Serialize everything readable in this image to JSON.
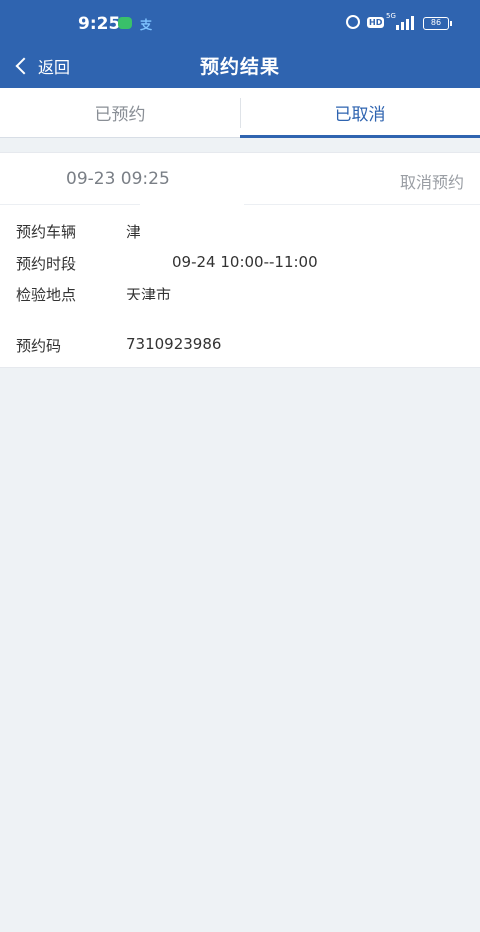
{
  "status_bar": {
    "time": "9:25",
    "alipay_glyph": "支",
    "hd": "HD",
    "network": "5G",
    "battery": "86"
  },
  "nav": {
    "back_label": "返回",
    "title": "预约结果"
  },
  "tabs": [
    {
      "label": "已预约",
      "active": false
    },
    {
      "label": "已取消",
      "active": true
    }
  ],
  "record": {
    "date": "09-23 09:25",
    "cancel_label": "取消预约",
    "fields": {
      "vehicle_label": "预约车辆",
      "vehicle_value": "津",
      "period_label": "预约时段",
      "period_value": "09-24 10:00--11:00",
      "location_label": "检验地点",
      "location_value": "天津市",
      "code_label": "预约码",
      "code_value": "7310923986"
    }
  },
  "colors": {
    "brand": "#2f64b0",
    "page_bg": "#eef2f5"
  }
}
